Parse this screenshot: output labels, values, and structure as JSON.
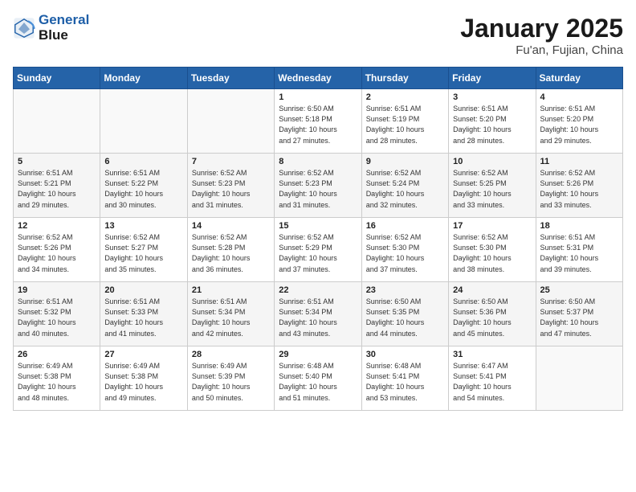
{
  "header": {
    "logo_line1": "General",
    "logo_line2": "Blue",
    "title": "January 2025",
    "subtitle": "Fu'an, Fujian, China"
  },
  "weekdays": [
    "Sunday",
    "Monday",
    "Tuesday",
    "Wednesday",
    "Thursday",
    "Friday",
    "Saturday"
  ],
  "weeks": [
    [
      {
        "day": "",
        "info": ""
      },
      {
        "day": "",
        "info": ""
      },
      {
        "day": "",
        "info": ""
      },
      {
        "day": "1",
        "info": "Sunrise: 6:50 AM\nSunset: 5:18 PM\nDaylight: 10 hours\nand 27 minutes."
      },
      {
        "day": "2",
        "info": "Sunrise: 6:51 AM\nSunset: 5:19 PM\nDaylight: 10 hours\nand 28 minutes."
      },
      {
        "day": "3",
        "info": "Sunrise: 6:51 AM\nSunset: 5:20 PM\nDaylight: 10 hours\nand 28 minutes."
      },
      {
        "day": "4",
        "info": "Sunrise: 6:51 AM\nSunset: 5:20 PM\nDaylight: 10 hours\nand 29 minutes."
      }
    ],
    [
      {
        "day": "5",
        "info": "Sunrise: 6:51 AM\nSunset: 5:21 PM\nDaylight: 10 hours\nand 29 minutes."
      },
      {
        "day": "6",
        "info": "Sunrise: 6:51 AM\nSunset: 5:22 PM\nDaylight: 10 hours\nand 30 minutes."
      },
      {
        "day": "7",
        "info": "Sunrise: 6:52 AM\nSunset: 5:23 PM\nDaylight: 10 hours\nand 31 minutes."
      },
      {
        "day": "8",
        "info": "Sunrise: 6:52 AM\nSunset: 5:23 PM\nDaylight: 10 hours\nand 31 minutes."
      },
      {
        "day": "9",
        "info": "Sunrise: 6:52 AM\nSunset: 5:24 PM\nDaylight: 10 hours\nand 32 minutes."
      },
      {
        "day": "10",
        "info": "Sunrise: 6:52 AM\nSunset: 5:25 PM\nDaylight: 10 hours\nand 33 minutes."
      },
      {
        "day": "11",
        "info": "Sunrise: 6:52 AM\nSunset: 5:26 PM\nDaylight: 10 hours\nand 33 minutes."
      }
    ],
    [
      {
        "day": "12",
        "info": "Sunrise: 6:52 AM\nSunset: 5:26 PM\nDaylight: 10 hours\nand 34 minutes."
      },
      {
        "day": "13",
        "info": "Sunrise: 6:52 AM\nSunset: 5:27 PM\nDaylight: 10 hours\nand 35 minutes."
      },
      {
        "day": "14",
        "info": "Sunrise: 6:52 AM\nSunset: 5:28 PM\nDaylight: 10 hours\nand 36 minutes."
      },
      {
        "day": "15",
        "info": "Sunrise: 6:52 AM\nSunset: 5:29 PM\nDaylight: 10 hours\nand 37 minutes."
      },
      {
        "day": "16",
        "info": "Sunrise: 6:52 AM\nSunset: 5:30 PM\nDaylight: 10 hours\nand 37 minutes."
      },
      {
        "day": "17",
        "info": "Sunrise: 6:52 AM\nSunset: 5:30 PM\nDaylight: 10 hours\nand 38 minutes."
      },
      {
        "day": "18",
        "info": "Sunrise: 6:51 AM\nSunset: 5:31 PM\nDaylight: 10 hours\nand 39 minutes."
      }
    ],
    [
      {
        "day": "19",
        "info": "Sunrise: 6:51 AM\nSunset: 5:32 PM\nDaylight: 10 hours\nand 40 minutes."
      },
      {
        "day": "20",
        "info": "Sunrise: 6:51 AM\nSunset: 5:33 PM\nDaylight: 10 hours\nand 41 minutes."
      },
      {
        "day": "21",
        "info": "Sunrise: 6:51 AM\nSunset: 5:34 PM\nDaylight: 10 hours\nand 42 minutes."
      },
      {
        "day": "22",
        "info": "Sunrise: 6:51 AM\nSunset: 5:34 PM\nDaylight: 10 hours\nand 43 minutes."
      },
      {
        "day": "23",
        "info": "Sunrise: 6:50 AM\nSunset: 5:35 PM\nDaylight: 10 hours\nand 44 minutes."
      },
      {
        "day": "24",
        "info": "Sunrise: 6:50 AM\nSunset: 5:36 PM\nDaylight: 10 hours\nand 45 minutes."
      },
      {
        "day": "25",
        "info": "Sunrise: 6:50 AM\nSunset: 5:37 PM\nDaylight: 10 hours\nand 47 minutes."
      }
    ],
    [
      {
        "day": "26",
        "info": "Sunrise: 6:49 AM\nSunset: 5:38 PM\nDaylight: 10 hours\nand 48 minutes."
      },
      {
        "day": "27",
        "info": "Sunrise: 6:49 AM\nSunset: 5:38 PM\nDaylight: 10 hours\nand 49 minutes."
      },
      {
        "day": "28",
        "info": "Sunrise: 6:49 AM\nSunset: 5:39 PM\nDaylight: 10 hours\nand 50 minutes."
      },
      {
        "day": "29",
        "info": "Sunrise: 6:48 AM\nSunset: 5:40 PM\nDaylight: 10 hours\nand 51 minutes."
      },
      {
        "day": "30",
        "info": "Sunrise: 6:48 AM\nSunset: 5:41 PM\nDaylight: 10 hours\nand 53 minutes."
      },
      {
        "day": "31",
        "info": "Sunrise: 6:47 AM\nSunset: 5:41 PM\nDaylight: 10 hours\nand 54 minutes."
      },
      {
        "day": "",
        "info": ""
      }
    ]
  ]
}
